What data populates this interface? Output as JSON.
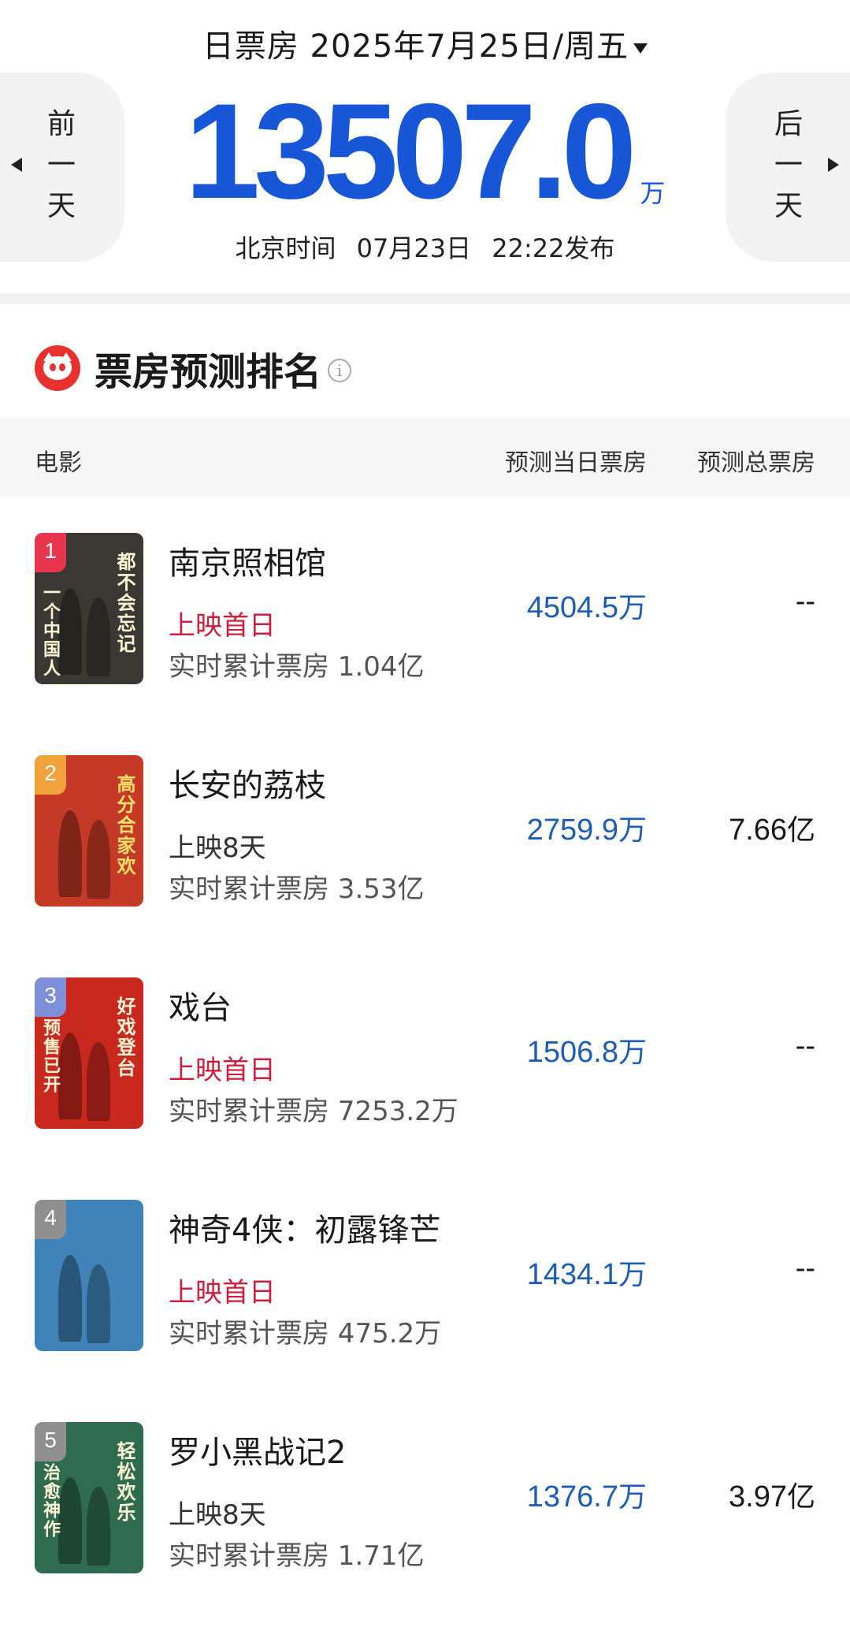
{
  "header": {
    "date_label": "日票房 2025年7月25日/周五",
    "prev_day": "前一天",
    "next_day": "后一天",
    "total_value": "13507.0",
    "total_unit": "万",
    "publish_prefix": "北京时间",
    "publish_date": "07月23日",
    "publish_time": "22:22发布"
  },
  "section": {
    "title": "票房预测排名"
  },
  "table": {
    "col_movie": "电影",
    "col_day": "预测当日票房",
    "col_total": "预测总票房",
    "rows": [
      {
        "rank": "1",
        "name": "南京照相馆",
        "status": "上映首日",
        "status_type": "first",
        "cumulative": "实时累计票房 1.04亿",
        "day_value": "4504.5",
        "day_unit": "万",
        "total_value": "--",
        "total_unit": "",
        "rank_color": "#e8364f",
        "poster_text_right": "都不会忘记",
        "poster_text_left": "一个中国人",
        "poster_bg": "#3b3833"
      },
      {
        "rank": "2",
        "name": "长安的荔枝",
        "status": "上映8天",
        "status_type": "days",
        "cumulative": "实时累计票房 3.53亿",
        "day_value": "2759.9",
        "day_unit": "万",
        "total_value": "7.66",
        "total_unit": "亿",
        "rank_color": "#f2a23a",
        "poster_text_right": "高分合家欢",
        "poster_text_left": "",
        "poster_bg": "#c43a26"
      },
      {
        "rank": "3",
        "name": "戏台",
        "status": "上映首日",
        "status_type": "first",
        "cumulative": "实时累计票房 7253.2万",
        "day_value": "1506.8",
        "day_unit": "万",
        "total_value": "--",
        "total_unit": "",
        "rank_color": "#7d8fd8",
        "poster_text_right": "好戏登台",
        "poster_text_left": "预售已开",
        "poster_bg": "#c8281e"
      },
      {
        "rank": "4",
        "name": "神奇4侠：初露锋芒",
        "status": "上映首日",
        "status_type": "first",
        "cumulative": "实时累计票房 475.2万",
        "day_value": "1434.1",
        "day_unit": "万",
        "total_value": "--",
        "total_unit": "",
        "rank_color": "#8f8f8f",
        "poster_text_right": "",
        "poster_text_left": "",
        "poster_bg": "#3f83b8"
      },
      {
        "rank": "5",
        "name": "罗小黑战记2",
        "status": "上映8天",
        "status_type": "days",
        "cumulative": "实时累计票房 1.71亿",
        "day_value": "1376.7",
        "day_unit": "万",
        "total_value": "3.97",
        "total_unit": "亿",
        "rank_color": "#8f8f8f",
        "poster_text_right": "轻松欢乐",
        "poster_text_left": "治愈神作",
        "poster_bg": "#2f6b4e"
      }
    ]
  },
  "colors": {
    "accent_blue": "#1756d6",
    "first_day_red": "#cc1f3d",
    "day_value_blue": "#1f5db5"
  }
}
